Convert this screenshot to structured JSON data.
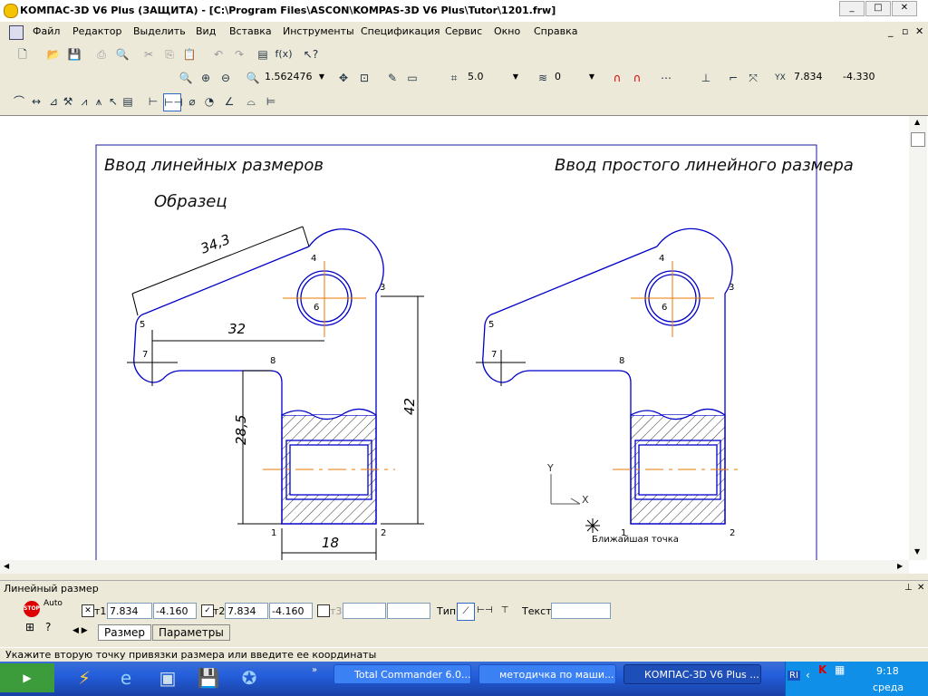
{
  "window": {
    "title": "КОМПАС-3D V6 Plus (ЗАЩИТА) - [C:\\Program Files\\ASCON\\KOMPAS-3D V6 Plus\\Tutor\\1201.frw]",
    "minimize": "_",
    "maximize": "□",
    "close": "✕"
  },
  "menu": [
    "Файл",
    "Редактор",
    "Выделить",
    "Вид",
    "Вставка",
    "Инструменты",
    "Спецификация",
    "Сервис",
    "Окно",
    "Справка"
  ],
  "toolbar": {
    "fx": "f(x)",
    "zoom": "1.562476",
    "step": "5.0",
    "layer": "0",
    "coord_x": "7.834",
    "coord_y": "-4.330"
  },
  "drawing": {
    "left_title": "Ввод линейных размеров",
    "right_title": "Ввод простого линейного размера",
    "sample": "Образец",
    "dims": {
      "d1": "34,3",
      "d2": "32",
      "d3": "42",
      "d4": "28,5",
      "d5": "18"
    },
    "points": [
      "1",
      "2",
      "3",
      "4",
      "5",
      "6",
      "7",
      "8"
    ],
    "axis_x": "X",
    "axis_y": "Y",
    "snap_hint": "Ближайшая точка"
  },
  "panel": {
    "title": "Линейный размер",
    "auto": "Auto",
    "stop": "STOP",
    "t1_label": "т1",
    "t1_x": "7.834",
    "t1_y": "-4.160",
    "t2_label": "т2",
    "t2_x": "7.834",
    "t2_y": "-4.160",
    "t3_label": "т3",
    "type_label": "Тип",
    "text_label": "Текст",
    "tabs": [
      "Размер",
      "Параметры"
    ]
  },
  "status": "Укажите вторую точку привязки размера или введите ее координаты",
  "taskbar": {
    "items": [
      "Total Commander 6.0...",
      "методичка по маши...",
      "КОМПАС-3D V6 Plus ..."
    ],
    "lang": "RI",
    "time": "9:18",
    "day": "среда"
  },
  "colors": {
    "drawing": "#0000c8",
    "axis": "#e87a00",
    "accent": "#245edb"
  }
}
